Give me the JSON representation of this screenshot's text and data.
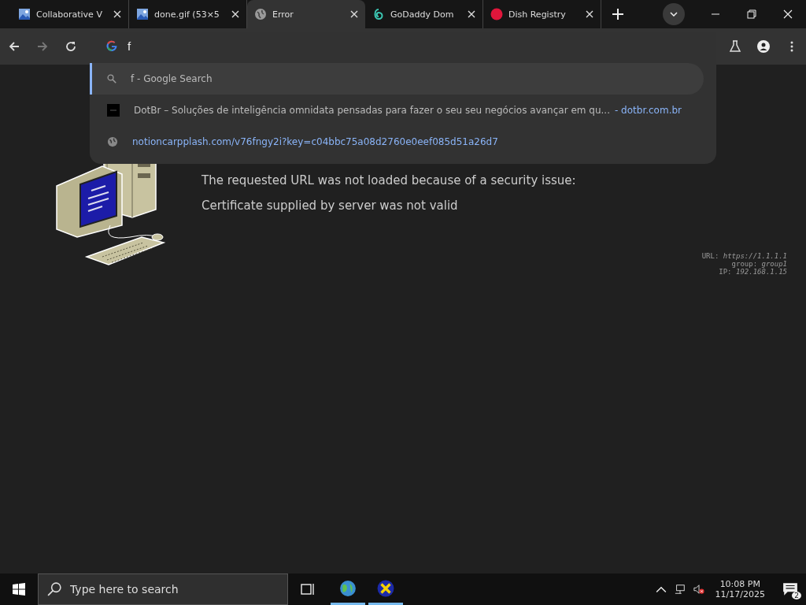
{
  "tabs": [
    {
      "title": "Collaborative V",
      "kind": "image",
      "selected": false
    },
    {
      "title": "done.gif (53×5",
      "kind": "image",
      "selected": false
    },
    {
      "title": "Error",
      "kind": "globe",
      "selected": true
    },
    {
      "title": "GoDaddy Dom",
      "kind": "swirl",
      "selected": false
    },
    {
      "title": "Dish Registry",
      "kind": "dot",
      "selected": false
    }
  ],
  "omnibox": {
    "value": "f"
  },
  "suggestions": [
    {
      "kind": "search",
      "text": "f - Google Search",
      "selected": true
    },
    {
      "kind": "site",
      "text": "DotBr – Soluções de inteligência omnidata pensadas para fazer o seu seu negócios avançar em qu...",
      "url": "- dotbr.com.br",
      "selected": false
    },
    {
      "kind": "url",
      "text": "notioncarpplash.com/v76fngy2i?key=c04bbc75a08d2760e0eef085d51a26d7",
      "selected": false
    }
  ],
  "page": {
    "message": "The requested URL was not loaded because of a security issue:",
    "detail": "Certificate supplied by server was not valid",
    "info": [
      {
        "label": "URL:",
        "value": "https://1.1.1.1"
      },
      {
        "label": "group:",
        "value": "group1"
      },
      {
        "label": "IP:",
        "value": "192.168.1.15"
      }
    ]
  },
  "taskbar": {
    "search_placeholder": "Type here to search",
    "time": "10:08 PM",
    "date": "11/17/2025",
    "notifications": "2"
  }
}
